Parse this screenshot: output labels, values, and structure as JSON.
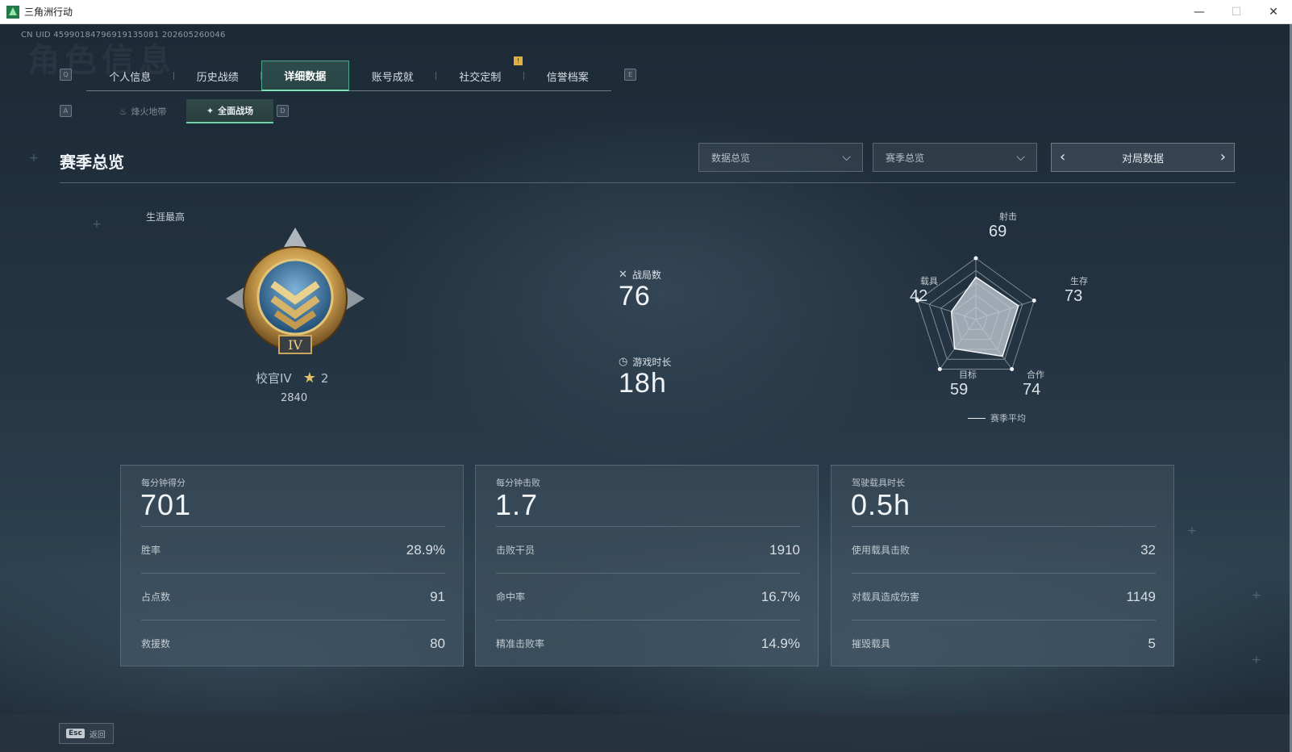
{
  "window": {
    "title": "三角洲行动",
    "minimize": "—",
    "maximize": "☐",
    "close": "✕"
  },
  "uid": "CN UID 45990184796919135081 202605260046",
  "ghost_title": "角色信息",
  "keyhints": {
    "prev_tab": "Q",
    "next_tab": "E",
    "prev_sub": "A",
    "next_sub": "D"
  },
  "tabs": [
    {
      "label": "个人信息",
      "active": false
    },
    {
      "label": "历史战绩",
      "active": false
    },
    {
      "label": "详细数据",
      "active": true
    },
    {
      "label": "账号成就",
      "active": false
    },
    {
      "label": "社交定制",
      "active": false
    },
    {
      "label": "信誉档案",
      "active": false
    }
  ],
  "tab_badge": "!",
  "subtabs": [
    {
      "label": "烽火地带",
      "active": false,
      "icon": "flame-icon"
    },
    {
      "label": "全面战场",
      "active": true,
      "icon": "battlefield-icon"
    }
  ],
  "section": {
    "title": "赛季总览",
    "select_data": "数据总览",
    "select_season": "赛季总览",
    "pager_label": "对局数据"
  },
  "rank": {
    "career_label": "生涯最高",
    "name": "校官IV",
    "stars": "2",
    "score": "2840",
    "emblem_numeral": "IV"
  },
  "summary": {
    "matches_label": "战局数",
    "matches_value": "76",
    "playtime_label": "游戏时长",
    "playtime_value": "18h"
  },
  "radar": {
    "axes": [
      {
        "label": "射击",
        "value": "69"
      },
      {
        "label": "生存",
        "value": "73"
      },
      {
        "label": "合作",
        "value": "74"
      },
      {
        "label": "目标",
        "value": "59"
      },
      {
        "label": "载具",
        "value": "42"
      }
    ],
    "legend": "赛季平均"
  },
  "cards": [
    {
      "head_label": "每分钟得分",
      "head_value": "701",
      "rows": [
        {
          "k": "胜率",
          "v": "28.9%"
        },
        {
          "k": "占点数",
          "v": "91"
        },
        {
          "k": "救援数",
          "v": "80"
        }
      ]
    },
    {
      "head_label": "每分钟击败",
      "head_value": "1.7",
      "rows": [
        {
          "k": "击败干员",
          "v": "1910"
        },
        {
          "k": "命中率",
          "v": "16.7%"
        },
        {
          "k": "精准击败率",
          "v": "14.9%"
        }
      ]
    },
    {
      "head_label": "驾驶载具时长",
      "head_value": "0.5h",
      "rows": [
        {
          "k": "使用载具击败",
          "v": "32"
        },
        {
          "k": "对载具造成伤害",
          "v": "1149"
        },
        {
          "k": "摧毁载具",
          "v": "5"
        }
      ]
    }
  ],
  "footer": {
    "esc_key": "Esc",
    "esc_label": "返回"
  }
}
